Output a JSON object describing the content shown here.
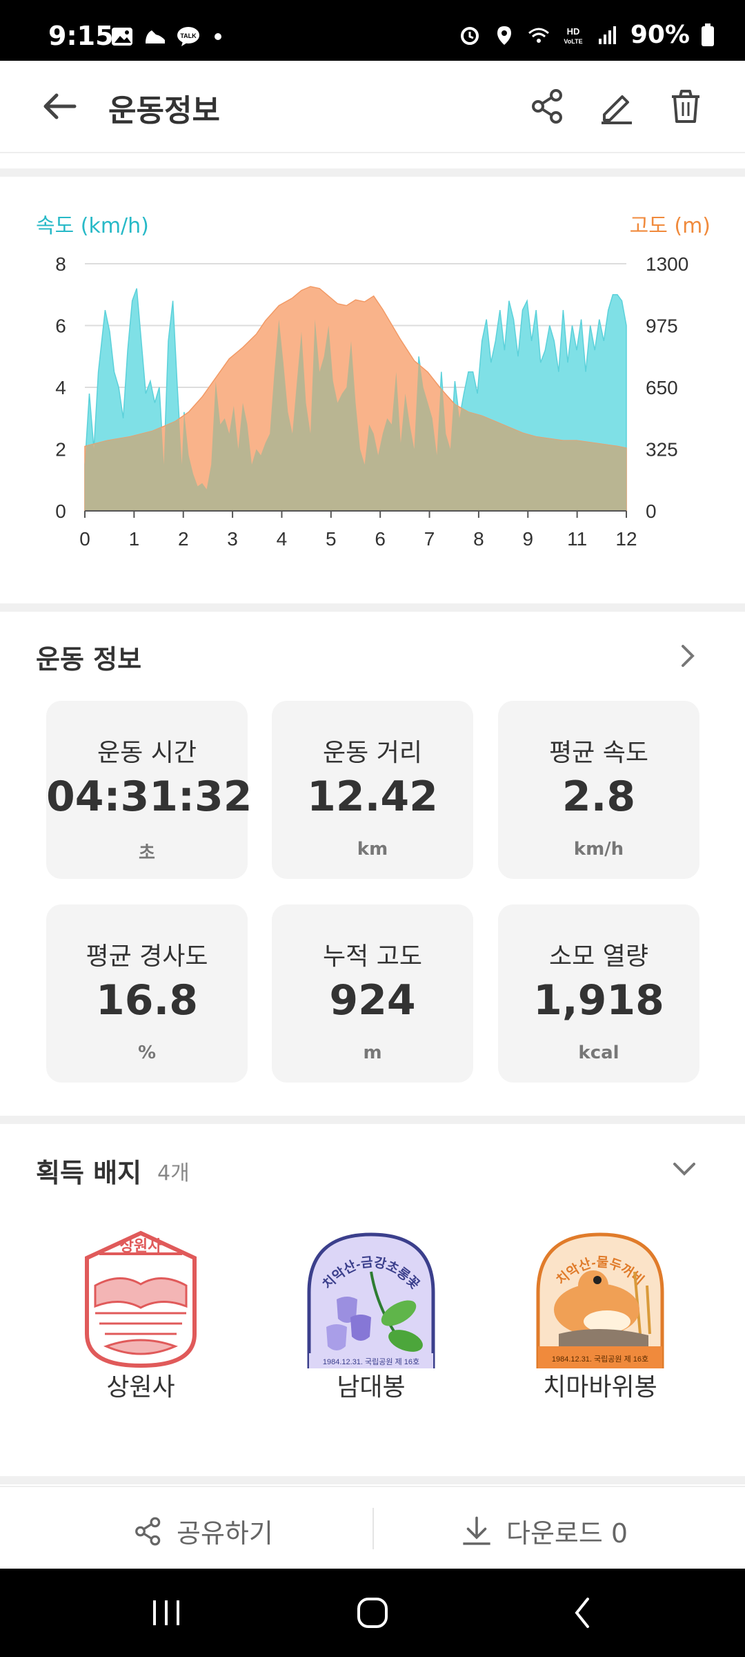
{
  "status": {
    "time": "9:15",
    "battery": "90%"
  },
  "header": {
    "title": "운동정보"
  },
  "chart_data": {
    "type": "area",
    "title": "",
    "y_left_label": "속도 (km/h)",
    "y_right_label": "고도 (m)",
    "x_ticks": [
      "0",
      "1",
      "2",
      "3",
      "4",
      "5",
      "6",
      "7",
      "8",
      "9",
      "11",
      "12"
    ],
    "y_left_ticks": [
      "0",
      "2",
      "4",
      "6",
      "8"
    ],
    "y_right_ticks": [
      "0",
      "325",
      "650",
      "975",
      "1300"
    ],
    "y_left_range": [
      0,
      8
    ],
    "y_right_range": [
      0,
      1300
    ],
    "x_range": [
      0,
      12
    ],
    "colors": {
      "speed": "#7fe0e6",
      "altitude": "#f9b38a",
      "overlap": "#b9b592"
    },
    "series": [
      {
        "name": "속도 (km/h)",
        "x": [
          0,
          0.1,
          0.2,
          0.3,
          0.45,
          0.55,
          0.65,
          0.75,
          0.85,
          0.95,
          1.05,
          1.15,
          1.25,
          1.35,
          1.45,
          1.55,
          1.65,
          1.75,
          1.85,
          1.95,
          2.05,
          2.15,
          2.2,
          2.3,
          2.4,
          2.5,
          2.6,
          2.7,
          2.8,
          2.9,
          3.0,
          3.1,
          3.2,
          3.3,
          3.4,
          3.5,
          3.6,
          3.7,
          3.8,
          3.9,
          4.0,
          4.1,
          4.2,
          4.3,
          4.4,
          4.5,
          4.6,
          4.7,
          4.8,
          4.9,
          5.0,
          5.1,
          5.2,
          5.3,
          5.4,
          5.5,
          5.6,
          5.7,
          5.8,
          5.9,
          6.0,
          6.1,
          6.2,
          6.3,
          6.4,
          6.5,
          6.6,
          6.7,
          6.8,
          6.9,
          7.0,
          7.1,
          7.2,
          7.3,
          7.4,
          7.5,
          7.6,
          7.7,
          7.8,
          7.9,
          8.0,
          8.1,
          8.2,
          8.3,
          8.4,
          8.5,
          8.6,
          8.7,
          8.8,
          8.9,
          9.0,
          9.1,
          9.2,
          9.3,
          9.4,
          9.5,
          9.6,
          9.7,
          9.8,
          9.9,
          10.0,
          10.1,
          10.2,
          10.3,
          10.4,
          10.5,
          10.6,
          10.7,
          10.8,
          10.9,
          11.0,
          11.1,
          11.2,
          11.3,
          11.4,
          11.5,
          11.6,
          11.7,
          11.8,
          11.9,
          12.0
        ],
        "values": [
          1.5,
          3.8,
          2.0,
          4.5,
          6.5,
          5.8,
          4.5,
          4.0,
          3.0,
          5.2,
          6.8,
          7.2,
          5.5,
          3.8,
          4.2,
          3.5,
          4.0,
          1.5,
          5.5,
          6.8,
          4.0,
          1.5,
          3.2,
          1.8,
          1.2,
          0.8,
          0.9,
          0.7,
          1.5,
          4.2,
          2.8,
          3.0,
          2.5,
          3.4,
          2.0,
          3.5,
          2.8,
          1.5,
          2.0,
          1.8,
          2.2,
          2.5,
          4.5,
          6.2,
          4.8,
          3.2,
          2.5,
          4.2,
          5.8,
          3.5,
          2.5,
          6.2,
          4.5,
          5.0,
          6.0,
          4.2,
          3.5,
          3.8,
          4.0,
          5.5,
          3.5,
          2.0,
          1.5,
          2.8,
          2.5,
          1.8,
          2.5,
          3.0,
          2.8,
          4.5,
          2.2,
          3.8,
          2.8,
          2.0,
          5.0,
          4.0,
          3.5,
          3.0,
          1.8,
          4.5,
          2.5,
          2.0,
          4.2,
          3.0,
          3.8,
          4.5,
          4.5,
          3.8,
          5.5,
          6.2,
          4.8,
          5.5,
          6.5,
          5.2,
          6.8,
          6.2,
          5.0,
          6.5,
          6.8,
          5.5,
          6.5,
          4.8,
          5.2,
          6.0,
          5.5,
          4.5,
          6.5,
          4.8,
          6.0,
          5.2,
          6.2,
          4.5,
          6.0,
          5.2,
          6.2,
          5.5,
          6.5,
          7.0,
          7.0,
          6.8,
          6.0
        ]
      },
      {
        "name": "고도 (m)",
        "x": [
          0,
          0.5,
          1.0,
          1.5,
          2.0,
          2.3,
          2.6,
          2.9,
          3.2,
          3.5,
          3.8,
          4.0,
          4.3,
          4.6,
          4.8,
          5.0,
          5.2,
          5.4,
          5.6,
          5.8,
          6.0,
          6.2,
          6.4,
          6.6,
          6.8,
          7.0,
          7.3,
          7.6,
          7.9,
          8.2,
          8.5,
          8.8,
          9.1,
          9.4,
          9.7,
          10.0,
          10.3,
          10.6,
          10.9,
          11.2,
          11.5,
          11.8,
          12.0
        ],
        "values": [
          340,
          370,
          390,
          420,
          470,
          520,
          600,
          700,
          800,
          860,
          930,
          1000,
          1080,
          1120,
          1160,
          1180,
          1170,
          1130,
          1090,
          1080,
          1110,
          1100,
          1130,
          1060,
          980,
          900,
          790,
          730,
          640,
          560,
          520,
          500,
          470,
          440,
          410,
          390,
          380,
          370,
          370,
          360,
          350,
          340,
          330
        ]
      }
    ]
  },
  "workout": {
    "title": "운동 정보",
    "cards": [
      {
        "label": "운동 시간",
        "value": "04:31:32",
        "unit": "초"
      },
      {
        "label": "운동 거리",
        "value": "12.42",
        "unit": "km"
      },
      {
        "label": "평균 속도",
        "value": "2.8",
        "unit": "km/h"
      },
      {
        "label": "평균 경사도",
        "value": "16.8",
        "unit": "%"
      },
      {
        "label": "누적 고도",
        "value": "924",
        "unit": "m"
      },
      {
        "label": "소모 열량",
        "value": "1,918",
        "unit": "kcal"
      }
    ]
  },
  "badges": {
    "title": "획득 배지",
    "count": "4개",
    "items": [
      {
        "name": "상원사",
        "seal_text": "상원사"
      },
      {
        "name": "남대봉",
        "seal_text": "치악산-금강초롱꽃",
        "caption": "1984.12.31. 국립공원 제 16호"
      },
      {
        "name": "치마바위봉",
        "seal_text": "치악산-물두꺼비",
        "caption": "1984.12.31. 국립공원 제 16호"
      }
    ]
  },
  "actions": {
    "share": "공유하기",
    "download": "다운로드 0"
  }
}
